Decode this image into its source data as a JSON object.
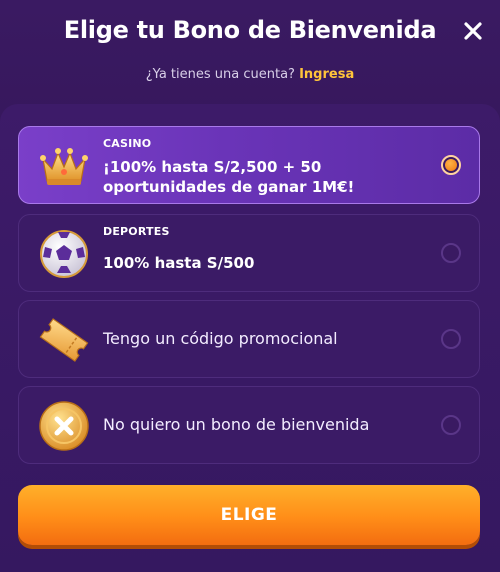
{
  "header": {
    "title": "Elige tu Bono de Bienvenida",
    "subtitle_question": "¿Ya tienes una cuenta?",
    "login_link": "Ingresa"
  },
  "options": [
    {
      "icon": "crown-icon",
      "kicker": "CASINO",
      "line1": "¡100% hasta S/2,500 + 50",
      "line2": "oportunidades de ganar 1M€!",
      "selected": true
    },
    {
      "icon": "soccer-ball-icon",
      "kicker": "DEPORTES",
      "line1": "100% hasta S/500",
      "selected": false
    },
    {
      "icon": "ticket-icon",
      "label": "Tengo un código promocional",
      "selected": false
    },
    {
      "icon": "no-bonus-coin-icon",
      "label": "No quiero un bono de bienvenida",
      "selected": false
    }
  ],
  "cta": {
    "label": "ELIGE"
  },
  "colors": {
    "background": "#351860",
    "accent_orange": "#ff8d18",
    "link_yellow": "#ffc43a",
    "selected_option": "#7a3fc9"
  }
}
